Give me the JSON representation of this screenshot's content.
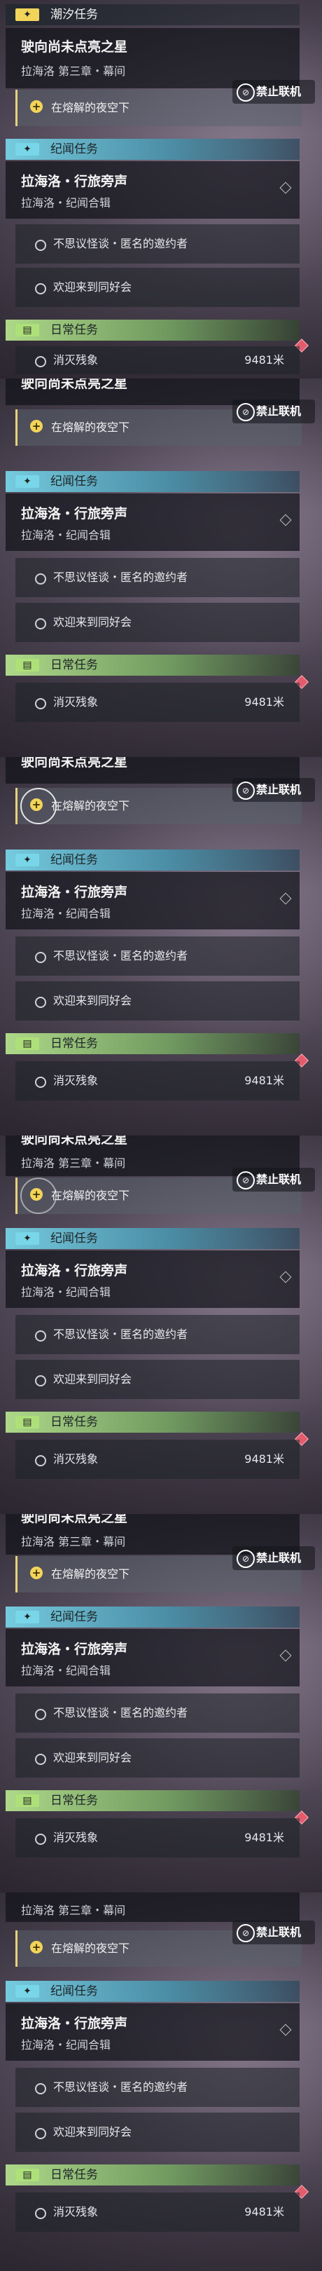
{
  "frames": [
    {
      "category_tide": "潮汐任务",
      "main_title": "驶向尚未点亮之星",
      "main_subtitle": "拉海洛 第三章・幕间",
      "selected_objective": "在熔解的夜空下",
      "banner": "禁止联机",
      "category_chronicle": "纪闻任务",
      "chronicle_title": "拉海洛・行旅旁声",
      "chronicle_subtitle": "拉海洛・纪闻合辑",
      "chronicle_items": [
        "不思议怪谈・匿名的邀约者",
        "欢迎来到同好会"
      ],
      "category_daily": "日常任务",
      "daily_items": [
        {
          "label": "消灭残象",
          "distance": "9481米"
        }
      ]
    },
    {
      "main_title_partial": "驶向尚未点亮之星",
      "selected_objective": "在熔解的夜空下",
      "banner": "禁止联机",
      "category_chronicle": "纪闻任务",
      "chronicle_title": "拉海洛・行旅旁声",
      "chronicle_subtitle": "拉海洛・纪闻合辑",
      "chronicle_items": [
        "不思议怪谈・匿名的邀约者",
        "欢迎来到同好会"
      ],
      "category_daily": "日常任务",
      "daily_items": [
        {
          "label": "消灭残象",
          "distance": "9481米"
        }
      ]
    },
    {
      "main_title_partial": "驶向尚未点亮之星",
      "selected_objective": "在熔解的夜空下",
      "banner": "禁止联机",
      "category_chronicle": "纪闻任务",
      "chronicle_title": "拉海洛・行旅旁声",
      "chronicle_subtitle": "拉海洛・纪闻合辑",
      "chronicle_items": [
        "不思议怪谈・匿名的邀约者",
        "欢迎来到同好会"
      ],
      "category_daily": "日常任务",
      "daily_items": [
        {
          "label": "消灭残象",
          "distance": "9481米"
        }
      ]
    },
    {
      "main_title_partial": "驶向尚未点亮之星",
      "main_subtitle": "拉海洛 第三章・幕间",
      "selected_objective": "在熔解的夜空下",
      "banner": "禁止联机",
      "category_chronicle": "纪闻任务",
      "chronicle_title": "拉海洛・行旅旁声",
      "chronicle_subtitle": "拉海洛・纪闻合辑",
      "chronicle_items": [
        "不思议怪谈・匿名的邀约者",
        "欢迎来到同好会"
      ],
      "category_daily": "日常任务",
      "daily_items": [
        {
          "label": "消灭残象",
          "distance": "9481米"
        }
      ]
    },
    {
      "main_title_partial": "驶向尚未点亮之星",
      "main_subtitle": "拉海洛 第三章・幕间",
      "selected_objective": "在熔解的夜空下",
      "banner": "禁止联机",
      "category_chronicle": "纪闻任务",
      "chronicle_title": "拉海洛・行旅旁声",
      "chronicle_subtitle": "拉海洛・纪闻合辑",
      "chronicle_items": [
        "不思议怪谈・匿名的邀约者",
        "欢迎来到同好会"
      ],
      "category_daily": "日常任务",
      "daily_items": [
        {
          "label": "消灭残象",
          "distance": "9481米"
        }
      ]
    },
    {
      "main_subtitle": "拉海洛 第三章・幕间",
      "selected_objective": "在熔解的夜空下",
      "banner": "禁止联机",
      "category_chronicle": "纪闻任务",
      "chronicle_title": "拉海洛・行旅旁声",
      "chronicle_subtitle": "拉海洛・纪闻合辑",
      "chronicle_items": [
        "不思议怪谈・匿名的邀约者",
        "欢迎来到同好会"
      ],
      "category_daily": "日常任务",
      "daily_items": [
        {
          "label": "消灭残象",
          "distance": "9481米"
        }
      ]
    }
  ]
}
